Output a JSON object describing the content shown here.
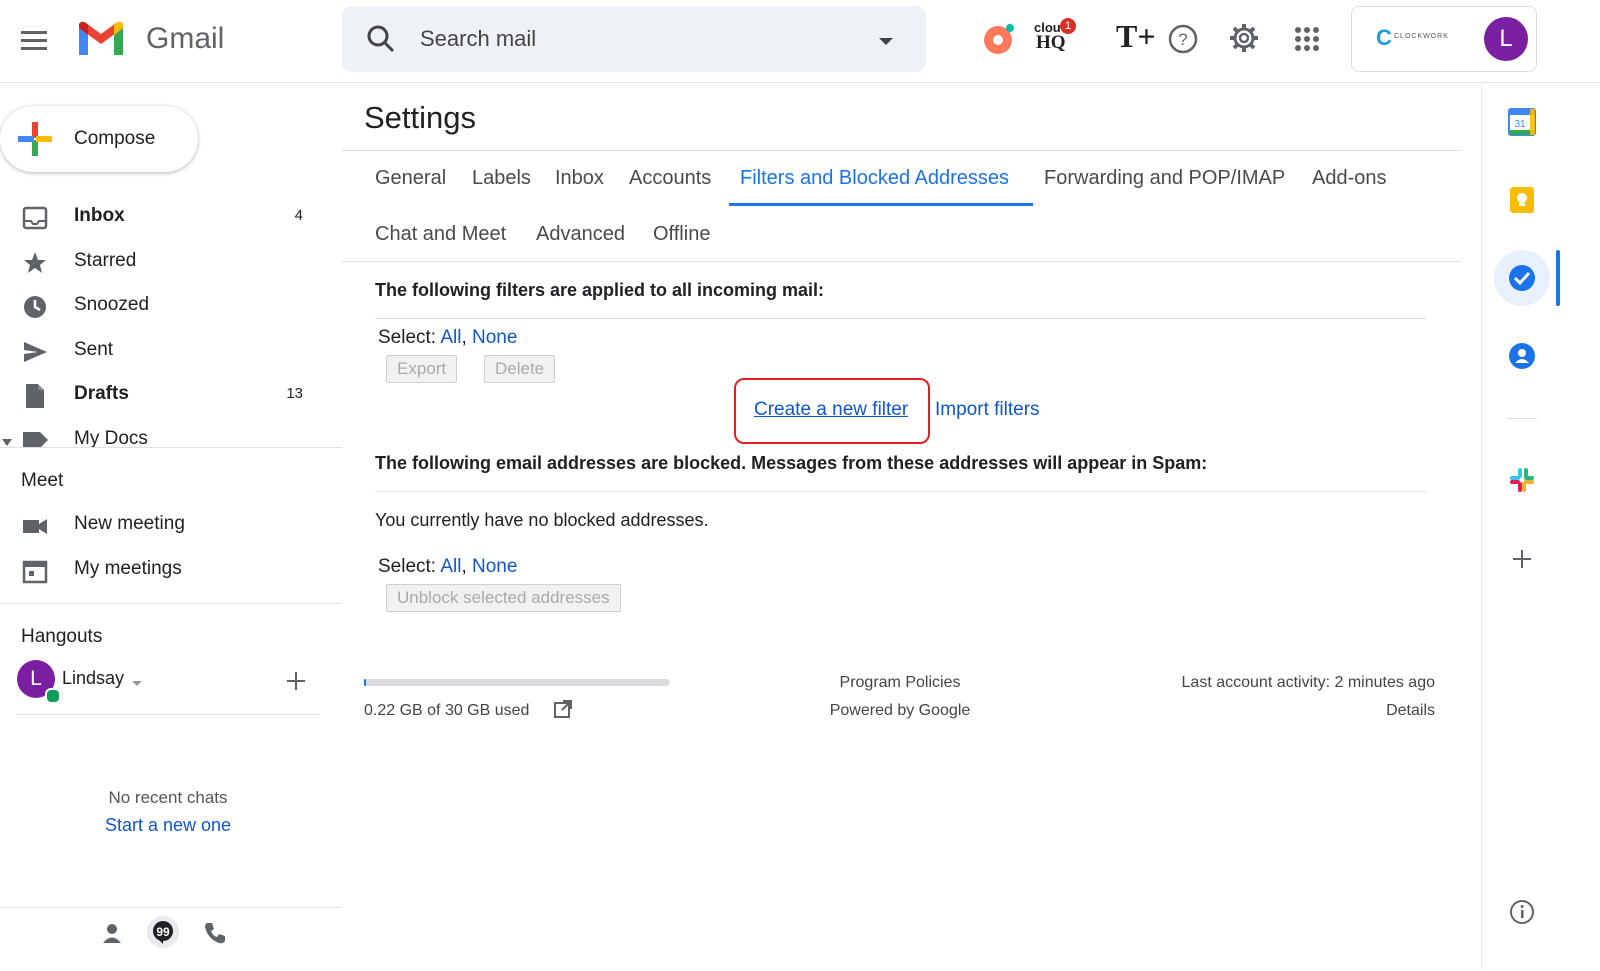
{
  "header": {
    "app_name": "Gmail",
    "search_placeholder": "Search mail",
    "account_brand": "CLOCKWORK",
    "avatar_initial": "L",
    "cloudhq_badge": "1",
    "cloudhq_text_top": "clou",
    "cloudhq_text_bottom": "HQ",
    "t_plus_text": "T+",
    "icons": [
      "menu-icon",
      "gmail-logo",
      "search-icon",
      "dropdown-icon",
      "hubspot-icon",
      "cloudhq-icon",
      "t-plus-icon",
      "help-icon",
      "gear-icon",
      "apps-grid-icon"
    ]
  },
  "sidebar": {
    "compose_label": "Compose",
    "items": [
      {
        "label": "Inbox",
        "count": "4",
        "bold": true,
        "icon": "inbox-icon"
      },
      {
        "label": "Starred",
        "count": "",
        "bold": false,
        "icon": "star-icon"
      },
      {
        "label": "Snoozed",
        "count": "",
        "bold": false,
        "icon": "clock-icon"
      },
      {
        "label": "Sent",
        "count": "",
        "bold": false,
        "icon": "send-icon"
      },
      {
        "label": "Drafts",
        "count": "13",
        "bold": true,
        "icon": "draft-icon"
      },
      {
        "label": "My Docs",
        "count": "",
        "bold": false,
        "icon": "label-icon"
      }
    ],
    "meet": {
      "title": "Meet",
      "new_meeting": "New meeting",
      "my_meetings": "My meetings"
    },
    "hangouts": {
      "title": "Hangouts",
      "user_initial": "L",
      "user_name": "Lindsay",
      "no_chats": "No recent chats",
      "start_new": "Start a new one"
    }
  },
  "settings": {
    "title": "Settings",
    "tabs_row1": [
      "General",
      "Labels",
      "Inbox",
      "Accounts",
      "Filters and Blocked Addresses",
      "Forwarding and POP/IMAP",
      "Add-ons"
    ],
    "tabs_row2": [
      "Chat and Meet",
      "Advanced",
      "Offline"
    ],
    "active_tab": "Filters and Blocked Addresses",
    "filters_heading": "The following filters are applied to all incoming mail:",
    "select_label": "Select:",
    "select_all": "All",
    "select_none": "None",
    "export_btn": "Export",
    "delete_btn": "Delete",
    "create_filter": "Create a new filter",
    "import_filters": "Import filters",
    "blocked_heading": "The following email addresses are blocked. Messages from these addresses will appear in Spam:",
    "no_blocked": "You currently have no blocked addresses.",
    "unblock_btn": "Unblock selected addresses"
  },
  "footer": {
    "storage": "0.22 GB of 30 GB used",
    "storage_fraction": 0.007,
    "program_policies": "Program Policies",
    "powered_by": "Powered by Google",
    "last_activity": "Last account activity: 2 minutes ago",
    "details": "Details"
  },
  "right_rail": {
    "calendar_day": "31",
    "icons": [
      "calendar-icon",
      "keep-icon",
      "tasks-icon",
      "contacts-icon",
      "slack-icon",
      "add-icon",
      "info-icon"
    ]
  },
  "colors": {
    "accent": "#1a73e8",
    "highlight_box": "#e02020",
    "avatar": "#7b1fa2",
    "link": "#1155cc"
  }
}
